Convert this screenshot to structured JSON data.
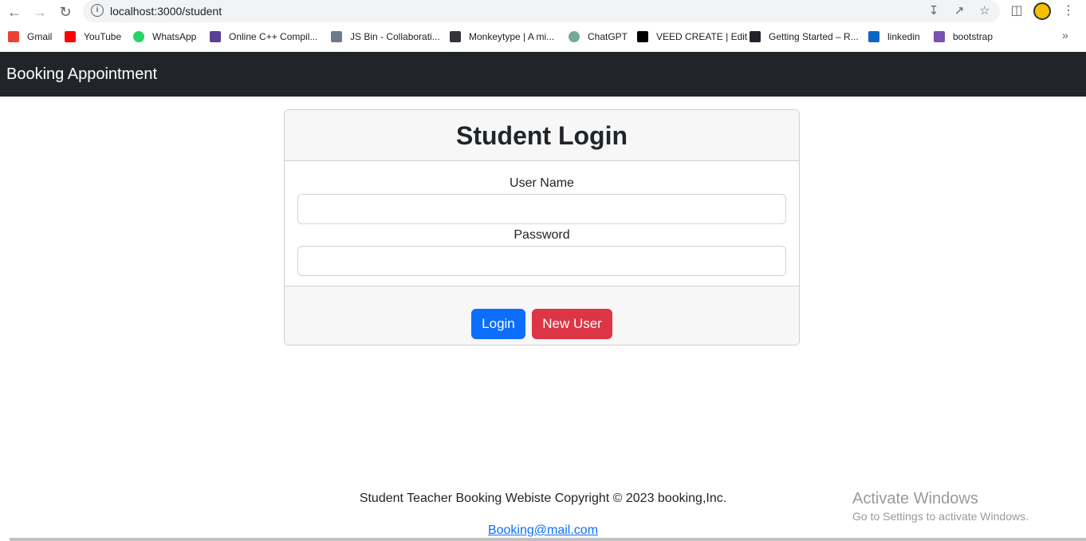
{
  "browser": {
    "url": "localhost:3000/student",
    "bookmarks": [
      {
        "label": "Gmail",
        "color": "#ea4335"
      },
      {
        "label": "YouTube",
        "color": "#ff0000"
      },
      {
        "label": "WhatsApp",
        "color": "#25d366"
      },
      {
        "label": "Online C++ Compil...",
        "color": "#5b3e96"
      },
      {
        "label": "JS Bin - Collaborati...",
        "color": "#6c7a89"
      },
      {
        "label": "Monkeytype | A mi...",
        "color": "#323437"
      },
      {
        "label": "ChatGPT",
        "color": "#74aa9c"
      },
      {
        "label": "VEED CREATE | Edit",
        "color": "#000000"
      },
      {
        "label": "Getting Started – R...",
        "color": "#20232a"
      },
      {
        "label": "linkedin",
        "color": "#0a66c2"
      },
      {
        "label": "bootstrap",
        "color": "#7952b3"
      }
    ],
    "more_label": "»"
  },
  "navbar": {
    "brand": "Booking Appointment"
  },
  "login": {
    "title": "Student Login",
    "username_label": "User Name",
    "username_value": "",
    "password_label": "Password",
    "password_value": "",
    "login_button": "Login",
    "new_user_button": "New User"
  },
  "footer": {
    "copyright": "Student Teacher Booking Webiste Copyright © 2023 booking,Inc.",
    "email": "Booking@mail.com"
  },
  "watermark": {
    "title": "Activate Windows",
    "subtitle": "Go to Settings to activate Windows."
  },
  "colors": {
    "navbar_bg": "#212529",
    "primary": "#0d6efd",
    "danger": "#dc3545"
  }
}
